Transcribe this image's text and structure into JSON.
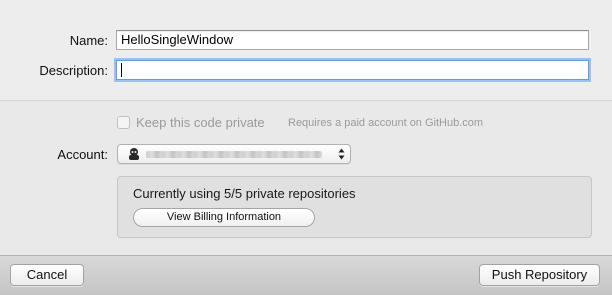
{
  "form": {
    "name_label": "Name:",
    "name_value": "HelloSingleWindow",
    "description_label": "Description:",
    "description_value": ""
  },
  "privacy": {
    "checkbox_label": "Keep this code private",
    "checkbox_checked": false,
    "hint": "Requires a paid account on GitHub.com"
  },
  "account": {
    "label": "Account:",
    "avatar_icon": "octocat-avatar-icon",
    "selected_value_obscured": true
  },
  "info": {
    "text": "Currently using 5/5 private repositories",
    "billing_button_label": "View Billing Information"
  },
  "footer": {
    "cancel_label": "Cancel",
    "push_label": "Push Repository"
  },
  "colors": {
    "focus_ring": "#9cc1ec",
    "disabled_text": "#9a9a9a",
    "background": "#ececec"
  }
}
